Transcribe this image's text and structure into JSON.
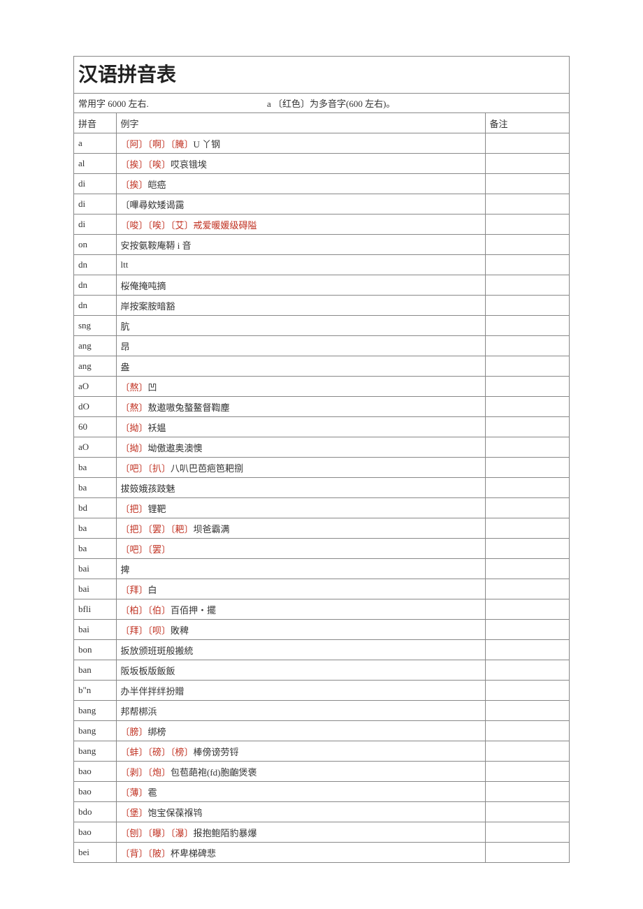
{
  "title": "汉语拼音表",
  "info_left": "常用字 6000 左右.",
  "info_right": "a 〔红色〕为多音字(600 左右)。",
  "headers": {
    "pinyin": "拼音",
    "example": "例字",
    "note": "备注"
  },
  "rows": [
    {
      "pinyin": "a",
      "segments": [
        {
          "t": "〔阿〕〔啊〕〔腌〕",
          "red": true
        },
        {
          "t": "U 丫钢"
        }
      ]
    },
    {
      "pinyin": "al",
      "segments": [
        {
          "t": "〔挨〕〔唉〕",
          "red": true
        },
        {
          "t": "哎哀锇埃"
        }
      ]
    },
    {
      "pinyin": "di",
      "segments": [
        {
          "t": "〔挨〕",
          "red": true
        },
        {
          "t": "皑癌"
        }
      ]
    },
    {
      "pinyin": "di",
      "segments": [
        {
          "t": "〔嗶尋欸矮谒靄"
        }
      ]
    },
    {
      "pinyin": "di",
      "segments": [
        {
          "t": "〔唆〕〔唉〕〔艾〕戒爱暖媛级碍隘",
          "red": true
        }
      ]
    },
    {
      "pinyin": "on",
      "segments": [
        {
          "t": "安按氨鞍庵鞯 i 音"
        }
      ]
    },
    {
      "pinyin": "dn",
      "segments": [
        {
          "t": "ltt"
        }
      ]
    },
    {
      "pinyin": "dn",
      "segments": [
        {
          "t": "桜俺掩吨摘"
        }
      ]
    },
    {
      "pinyin": "dn",
      "segments": [
        {
          "t": "岸按案胺暗豁"
        }
      ]
    },
    {
      "pinyin": "sng",
      "segments": [
        {
          "t": "肮"
        }
      ]
    },
    {
      "pinyin": "ang",
      "segments": [
        {
          "t": "昂"
        }
      ]
    },
    {
      "pinyin": "ang",
      "segments": [
        {
          "t": "盎"
        }
      ]
    },
    {
      "pinyin": "aO",
      "segments": [
        {
          "t": "〔熬〕",
          "red": true
        },
        {
          "t": "凹"
        }
      ]
    },
    {
      "pinyin": "dO",
      "segments": [
        {
          "t": "〔熬〕",
          "red": true
        },
        {
          "t": "敖遨嗷兔螯鳌督鞫塵"
        }
      ]
    },
    {
      "pinyin": "60",
      "segments": [
        {
          "t": "〔拗〕",
          "red": true
        },
        {
          "t": "袄媪"
        }
      ]
    },
    {
      "pinyin": "aO",
      "segments": [
        {
          "t": "〔拗〕",
          "red": true
        },
        {
          "t": "坳傲遨奥澳懊"
        }
      ]
    },
    {
      "pinyin": "ba",
      "segments": [
        {
          "t": "〔吧〕〔扒〕",
          "red": true
        },
        {
          "t": "八叭巴芭疤笆耙捌"
        }
      ]
    },
    {
      "pinyin": "ba",
      "segments": [
        {
          "t": "拔笯娥孩跂魅"
        }
      ]
    },
    {
      "pinyin": "bd",
      "segments": [
        {
          "t": "〔把〕",
          "red": true
        },
        {
          "t": "锂靶"
        }
      ]
    },
    {
      "pinyin": "ba",
      "segments": [
        {
          "t": "〔把〕〔罢〕〔耙〕",
          "red": true
        },
        {
          "t": "坝爸霸满"
        }
      ]
    },
    {
      "pinyin": "ba",
      "segments": [
        {
          "t": "〔吧〕〔罢〕",
          "red": true
        }
      ]
    },
    {
      "pinyin": "bai",
      "segments": [
        {
          "t": "捭"
        }
      ]
    },
    {
      "pinyin": "bai",
      "segments": [
        {
          "t": "〔拜〕",
          "red": true
        },
        {
          "t": "白"
        }
      ]
    },
    {
      "pinyin": "bfli",
      "segments": [
        {
          "t": "〔柏〕〔伯〕",
          "red": true
        },
        {
          "t": "百佰押・擺"
        }
      ]
    },
    {
      "pinyin": "bai",
      "segments": [
        {
          "t": "〔拜〕〔呗〕",
          "red": true
        },
        {
          "t": "敗稗"
        }
      ]
    },
    {
      "pinyin": "bon",
      "segments": [
        {
          "t": "扳放颁班斑般搬統"
        }
      ]
    },
    {
      "pinyin": "ban",
      "segments": [
        {
          "t": "阪坂板版飯飯"
        }
      ]
    },
    {
      "pinyin": "b\"n",
      "segments": [
        {
          "t": "办半伴拌绊扮贈"
        }
      ]
    },
    {
      "pinyin": "bang",
      "segments": [
        {
          "t": "邦帮梆浜"
        }
      ]
    },
    {
      "pinyin": "bang",
      "segments": [
        {
          "t": "〔膀〕",
          "red": true
        },
        {
          "t": "绑榜"
        }
      ]
    },
    {
      "pinyin": "bang",
      "segments": [
        {
          "t": "〔蚌〕〔磅〕〔榜〕",
          "red": true
        },
        {
          "t": "棒傍谤劳锊"
        }
      ]
    },
    {
      "pinyin": "bao",
      "segments": [
        {
          "t": "〔剥〕〔炮〕",
          "red": true
        },
        {
          "t": "包苞葩袍(fd)胞齙煲褒"
        }
      ]
    },
    {
      "pinyin": "bao",
      "segments": [
        {
          "t": "〔薄〕",
          "red": true
        },
        {
          "t": "雹"
        }
      ]
    },
    {
      "pinyin": "bdo",
      "segments": [
        {
          "t": "〔堡〕",
          "red": true
        },
        {
          "t": "饱宝保葆褓鸨"
        }
      ]
    },
    {
      "pinyin": "bao",
      "segments": [
        {
          "t": "〔刨〕〔曝〕〔瀑〕",
          "red": true
        },
        {
          "t": "报抱鲍陌豹暴爆"
        }
      ]
    },
    {
      "pinyin": "bei",
      "segments": [
        {
          "t": "〔背〕〔陂〕",
          "red": true
        },
        {
          "t": "杯卑梯碑悲"
        }
      ]
    }
  ]
}
